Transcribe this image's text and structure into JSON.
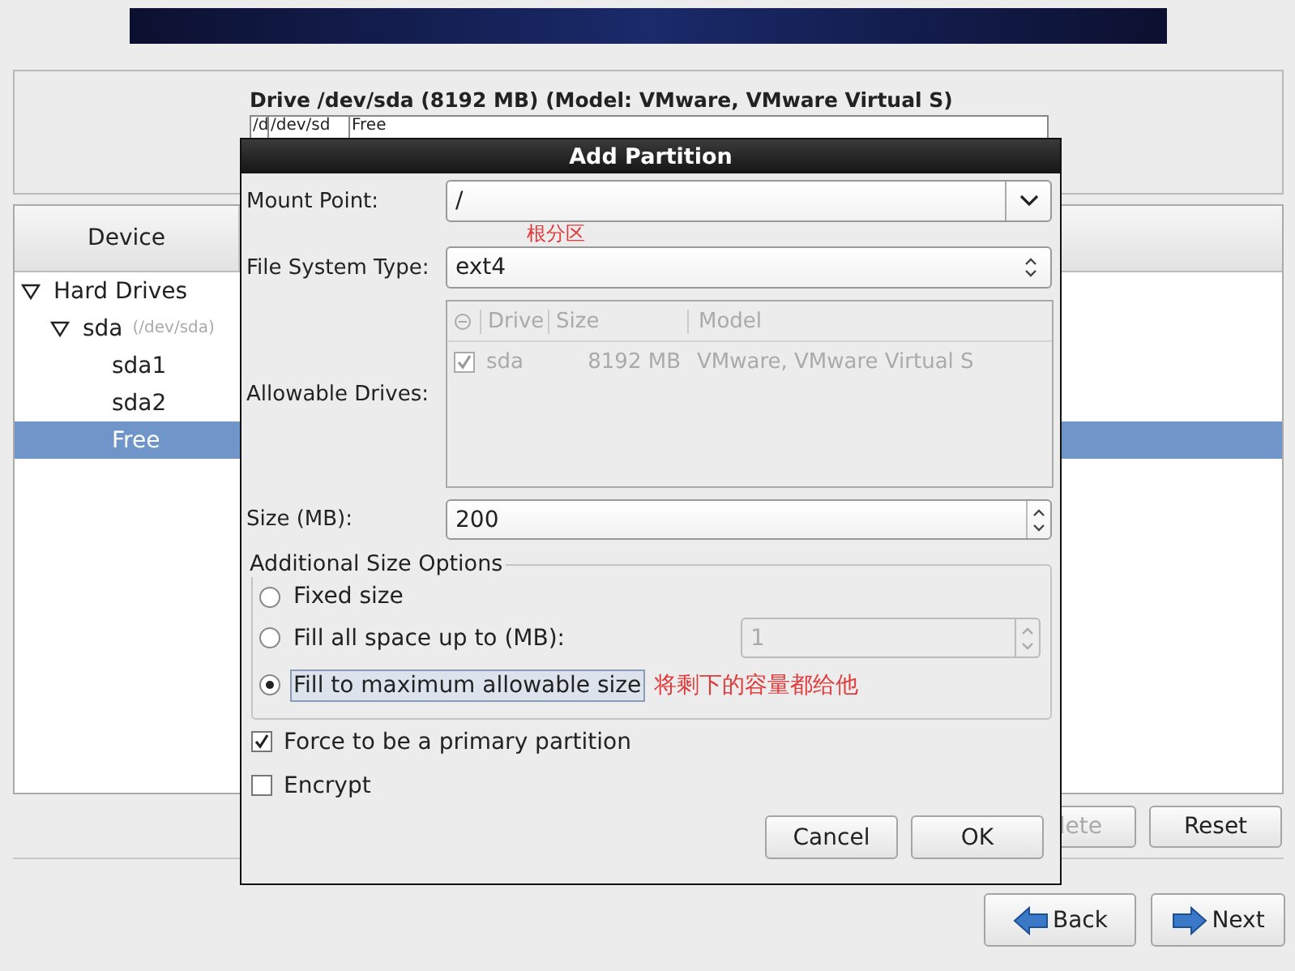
{
  "drive_panel": {
    "title": "Drive /dev/sda (8192 MB) (Model: VMware, VMware Virtual S)",
    "segments": [
      {
        "label": "/d"
      },
      {
        "label": "/dev/sd"
      },
      {
        "label": "Free"
      }
    ]
  },
  "device_table": {
    "columns": [
      "Device"
    ],
    "tree": [
      {
        "label": "Hard Drives",
        "expanded": true,
        "selected": false,
        "children": [
          {
            "label": "sda",
            "detail": "(/dev/sda)",
            "expanded": true,
            "selected": false,
            "children": [
              {
                "label": "sda1",
                "selected": false
              },
              {
                "label": "sda2",
                "selected": false
              },
              {
                "label": "Free",
                "selected": true
              }
            ]
          }
        ]
      }
    ]
  },
  "actions": [
    {
      "label": "lete",
      "disabled": true
    },
    {
      "label": "Reset",
      "disabled": false
    }
  ],
  "navigation": [
    {
      "label": "Back",
      "kind": "back"
    },
    {
      "label": "Next",
      "kind": "next"
    }
  ],
  "dialog": {
    "title": "Add Partition",
    "mount_point": {
      "label": "Mount Point:",
      "value": "/",
      "annotation": "根分区"
    },
    "file_system": {
      "label": "File System Type:",
      "value": "ext4"
    },
    "allowable_drives": {
      "label": "Allowable Drives:",
      "columns": [
        "Drive",
        "Size",
        "Model"
      ],
      "rows": [
        {
          "checked": true,
          "drive": "sda",
          "size": "8192 MB",
          "model": "VMware, VMware Virtual S"
        }
      ]
    },
    "size": {
      "label": "Size (MB):",
      "value": "200"
    },
    "size_options": {
      "title": "Additional Size Options",
      "options": [
        {
          "label": "Fixed size",
          "selected": false
        },
        {
          "label": "Fill all space up to (MB):",
          "selected": false,
          "spin_value": "1"
        },
        {
          "label": "Fill to maximum allowable size",
          "selected": true,
          "annotation": "将剩下的容量都给他"
        }
      ]
    },
    "checkboxes": [
      {
        "label": "Force to be a primary partition",
        "checked": true
      },
      {
        "label": "Encrypt",
        "checked": false
      }
    ],
    "buttons": [
      "Cancel",
      "OK"
    ]
  }
}
